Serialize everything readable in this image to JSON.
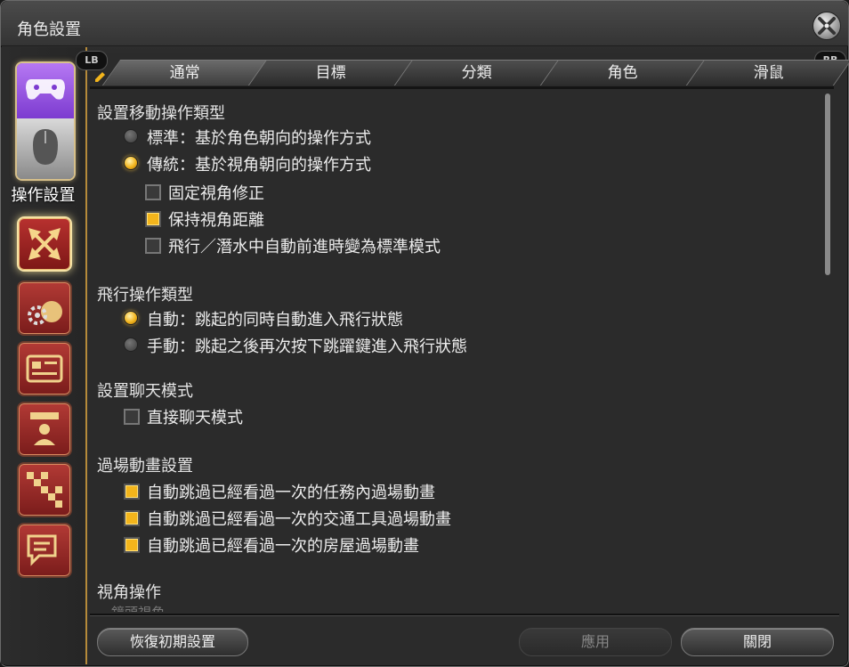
{
  "window": {
    "title": "角色設置"
  },
  "sidebar": {
    "active_label": "操作設置",
    "items": [
      {
        "icon": "gamepad-mouse-icon"
      },
      {
        "icon": "arrows-expand-icon"
      },
      {
        "icon": "gears-bag-icon"
      },
      {
        "icon": "id-card-icon"
      },
      {
        "icon": "character-profile-icon"
      },
      {
        "icon": "checkered-path-icon"
      },
      {
        "icon": "chat-bubbles-icon"
      }
    ]
  },
  "tabs": {
    "lb": "LB",
    "rb": "RB",
    "items": [
      "通常",
      "目標",
      "分類",
      "角色",
      "滑鼠"
    ],
    "active": 0
  },
  "sections": {
    "move": {
      "heading": "設置移動操作類型",
      "opt1": "標準：基於角色朝向的操作方式",
      "opt2": "傳統：基於視角朝向的操作方式",
      "chk1": "固定視角修正",
      "chk2": "保持視角距離",
      "chk3": "飛行／潛水中自動前進時變為標準模式"
    },
    "fly": {
      "heading": "飛行操作類型",
      "opt1": "自動：跳起的同時自動進入飛行狀態",
      "opt2": "手動：跳起之後再次按下跳躍鍵進入飛行狀態"
    },
    "chat": {
      "heading": "設置聊天模式",
      "chk1": "直接聊天模式"
    },
    "cutscene": {
      "heading": "過場動畫設置",
      "chk1": "自動跳過已經看過一次的任務內過場動畫",
      "chk2": "自動跳過已經看過一次的交通工具過場動畫",
      "chk3": "自動跳過已經看過一次的房屋過場動畫"
    },
    "camera": {
      "heading": "視角操作",
      "partial": "鏡頭視角"
    }
  },
  "buttons": {
    "reset": "恢復初期設置",
    "apply": "應用",
    "close": "關閉"
  },
  "colors": {
    "accent": "#f3b51c",
    "sidebar_border": "#b58a3a",
    "icon_red": "#b23a35"
  }
}
